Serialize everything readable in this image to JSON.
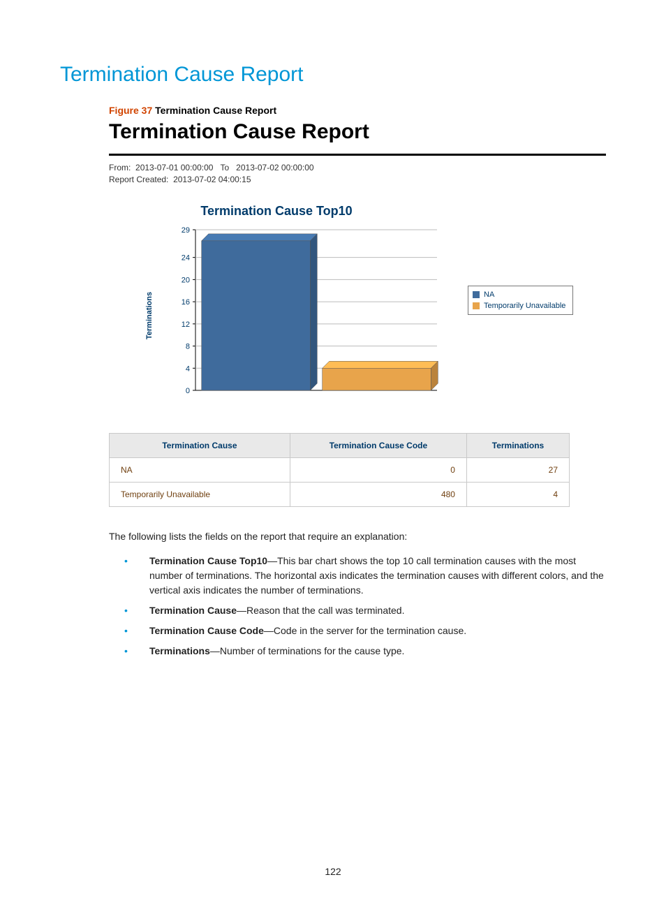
{
  "page_title": "Termination Cause Report",
  "figure_label": "Figure 37",
  "figure_title": "Termination Cause Report",
  "report_title": "Termination Cause Report",
  "meta": {
    "from_lbl": "From:",
    "from_val": "2013-07-01 00:00:00",
    "to_lbl": "To",
    "to_val": "2013-07-02 00:00:00",
    "created_lbl": "Report Created:",
    "created_val": "2013-07-02 04:00:15"
  },
  "chart_data": {
    "type": "bar",
    "title": "Termination Cause Top10",
    "ylabel": "Terminations",
    "xlabel": "",
    "y_ticks": [
      0,
      4,
      8,
      12,
      16,
      20,
      24,
      29
    ],
    "ylim": [
      0,
      29
    ],
    "categories": [
      "NA",
      "Temporarily Unavailable"
    ],
    "values": [
      27,
      4
    ],
    "colors": {
      "NA": "#3f6b9c",
      "Temporarily Unavailable": "#e8a44b"
    },
    "legend": [
      "NA",
      "Temporarily Unavailable"
    ]
  },
  "table": {
    "headers": [
      "Termination Cause",
      "Termination Cause Code",
      "Terminations"
    ],
    "rows": [
      {
        "cause": "NA",
        "code": "0",
        "count": "27"
      },
      {
        "cause": "Temporarily Unavailable",
        "code": "480",
        "count": "4"
      }
    ]
  },
  "intro": "The following lists the fields on the report that require an explanation:",
  "fields": [
    {
      "term": "Termination Cause Top10",
      "desc": "—This bar chart shows the top 10 call termination causes with the most number of terminations. The horizontal axis indicates the termination causes with different colors, and the vertical axis indicates the number of terminations."
    },
    {
      "term": "Termination Cause",
      "desc": "—Reason that the call was terminated."
    },
    {
      "term": "Termination Cause Code",
      "desc": "—Code in the server for the termination cause."
    },
    {
      "term": "Terminations",
      "desc": "—Number of terminations for the cause type."
    }
  ],
  "page_number": "122"
}
